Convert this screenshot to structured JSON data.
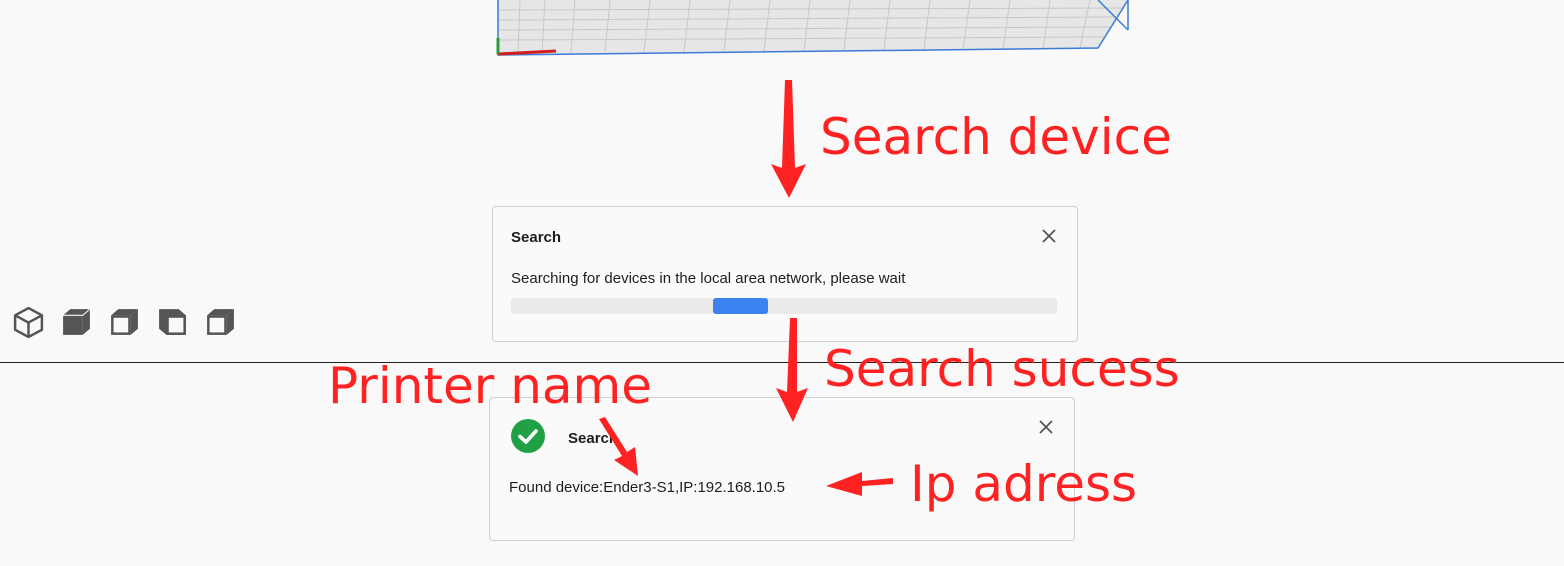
{
  "search_dialog": {
    "title": "Search",
    "message": "Searching for devices in the local area network, please wait",
    "progress": {
      "start": 0.37,
      "end": 0.47
    },
    "close_icon": "close-icon"
  },
  "success_dialog": {
    "title": "Search",
    "message": "Found device:Ender3-S1,IP:192.168.10.5",
    "status_icon": "check-circle-icon",
    "close_icon": "close-icon"
  },
  "view_icons": [
    "iso-view-icon",
    "front-view-icon",
    "left-view-icon",
    "top-view-icon",
    "right-view-icon"
  ],
  "annotations": {
    "search_device": "Search device",
    "search_success": "Search sucess",
    "printer_name": "Printer name",
    "ip_address": "Ip adress"
  },
  "colors": {
    "annotation": "#ff2222",
    "progress": "#3b82f0",
    "success": "#22a046",
    "plate_edge": "#3a7bd5"
  }
}
